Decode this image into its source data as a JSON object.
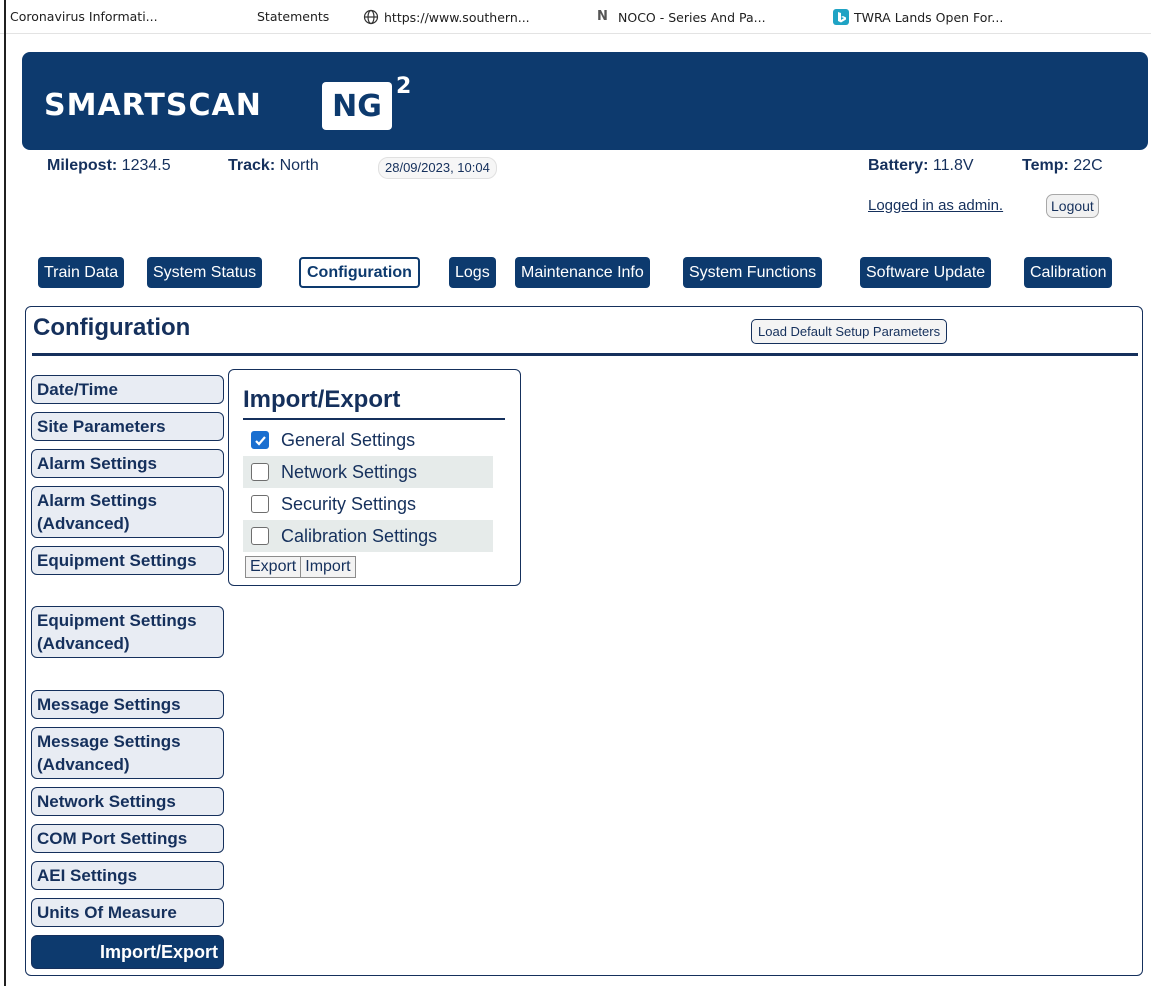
{
  "bookmarks": [
    {
      "label": "Coronavirus Informati...",
      "icon": "none"
    },
    {
      "label": "Statements",
      "icon": "none"
    },
    {
      "label": "https://www.southern...",
      "icon": "globe-icon"
    },
    {
      "label": "NOCO - Series And Pa...",
      "icon": "noco-logo-icon"
    },
    {
      "label": "TWRA Lands Open For...",
      "icon": "bing-icon"
    }
  ],
  "brand": {
    "name": "SMARTSCAN",
    "badge": "NG",
    "sup": "2"
  },
  "status": {
    "milepost_label": "Milepost:",
    "milepost": "1234.5",
    "track_label": "Track:",
    "track": "North",
    "datetime": "28/09/2023, 10:04",
    "battery_label": "Battery:",
    "battery": "11.8V",
    "temp_label": "Temp:",
    "temp": "22C",
    "logged_in": "Logged in as admin.",
    "logout": "Logout"
  },
  "tabs": [
    {
      "label": "Train Data"
    },
    {
      "label": "System Status"
    },
    {
      "label": "Configuration",
      "active": true
    },
    {
      "label": "Logs"
    },
    {
      "label": "Maintenance Info"
    },
    {
      "label": "System Functions"
    },
    {
      "label": "Software Update"
    },
    {
      "label": "Calibration"
    }
  ],
  "panel": {
    "title": "Configuration",
    "load_defaults": "Load Default Setup Parameters"
  },
  "side_menu": [
    {
      "label": "Date/Time"
    },
    {
      "label": "Site Parameters"
    },
    {
      "label": "Alarm Settings"
    },
    {
      "label": "Alarm Settings (Advanced)"
    },
    {
      "label": "Equipment Settings"
    },
    {
      "label": "Equipment Settings (Advanced)"
    },
    {
      "label": "Message Settings"
    },
    {
      "label": "Message Settings (Advanced)"
    },
    {
      "label": "Network Settings"
    },
    {
      "label": "COM Port Settings"
    },
    {
      "label": "AEI Settings"
    },
    {
      "label": "Units Of Measure"
    },
    {
      "label": "Import/Export",
      "active": true
    }
  ],
  "import_export": {
    "title": "Import/Export",
    "options": [
      {
        "label": "General Settings",
        "checked": true
      },
      {
        "label": "Network Settings",
        "checked": false
      },
      {
        "label": "Security Settings",
        "checked": false
      },
      {
        "label": "Calibration Settings",
        "checked": false
      }
    ],
    "export_label": "Export",
    "import_label": "Import"
  },
  "colors": {
    "navy": "#0d3a6e",
    "text": "#15305c",
    "checkbox": "#1a6fd0"
  }
}
